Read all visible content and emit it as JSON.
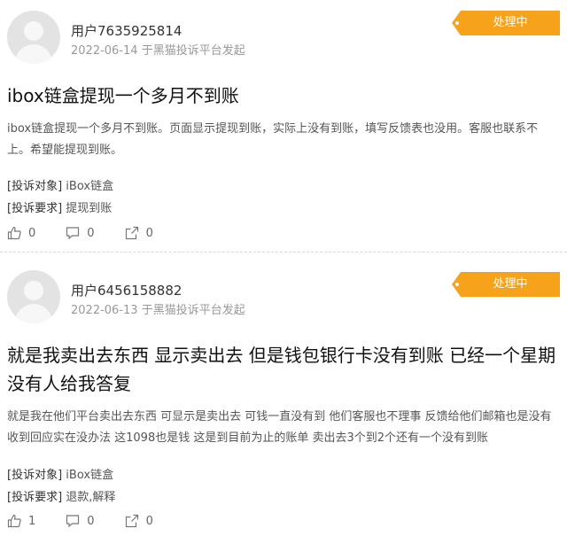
{
  "complaints": [
    {
      "username": "用户7635925814",
      "date": "2022-06-14",
      "source": "于黑猫投诉平台发起",
      "status": "处理中",
      "title": "ibox链盒提现一个多月不到账",
      "body": "ibox链盒提现一个多月不到账。页面显示提现到账，实际上没有到账，填写反馈表也没用。客服也联系不上。希望能提现到账。",
      "target_label": "[投诉对象]",
      "target_value": "iBox链盒",
      "request_label": "[投诉要求]",
      "request_value": "提现到账",
      "likes": "0",
      "comments": "0",
      "shares": "0"
    },
    {
      "username": "用户6456158882",
      "date": "2022-06-13",
      "source": "于黑猫投诉平台发起",
      "status": "处理中",
      "title": "就是我卖出去东西 显示卖出去 但是钱包银行卡没有到账 已经一个星期没有人给我答复",
      "body": "就是我在他们平台卖出去东西 可显示是卖出去 可钱一直没有到 他们客服也不理事 反馈给他们邮箱也是没有收到回应实在没办法 这1098也是钱 这是到目前为止的账单 卖出去3个到2个还有一个没有到账",
      "target_label": "[投诉对象]",
      "target_value": "iBox链盒",
      "request_label": "[投诉要求]",
      "request_value": "退款,解释",
      "likes": "1",
      "comments": "0",
      "shares": "0"
    }
  ],
  "colors": {
    "badge": "#f6a21b",
    "meta": "#999999",
    "text": "#555555"
  },
  "icons": [
    "thumbs-up-icon",
    "comment-icon",
    "share-icon"
  ]
}
